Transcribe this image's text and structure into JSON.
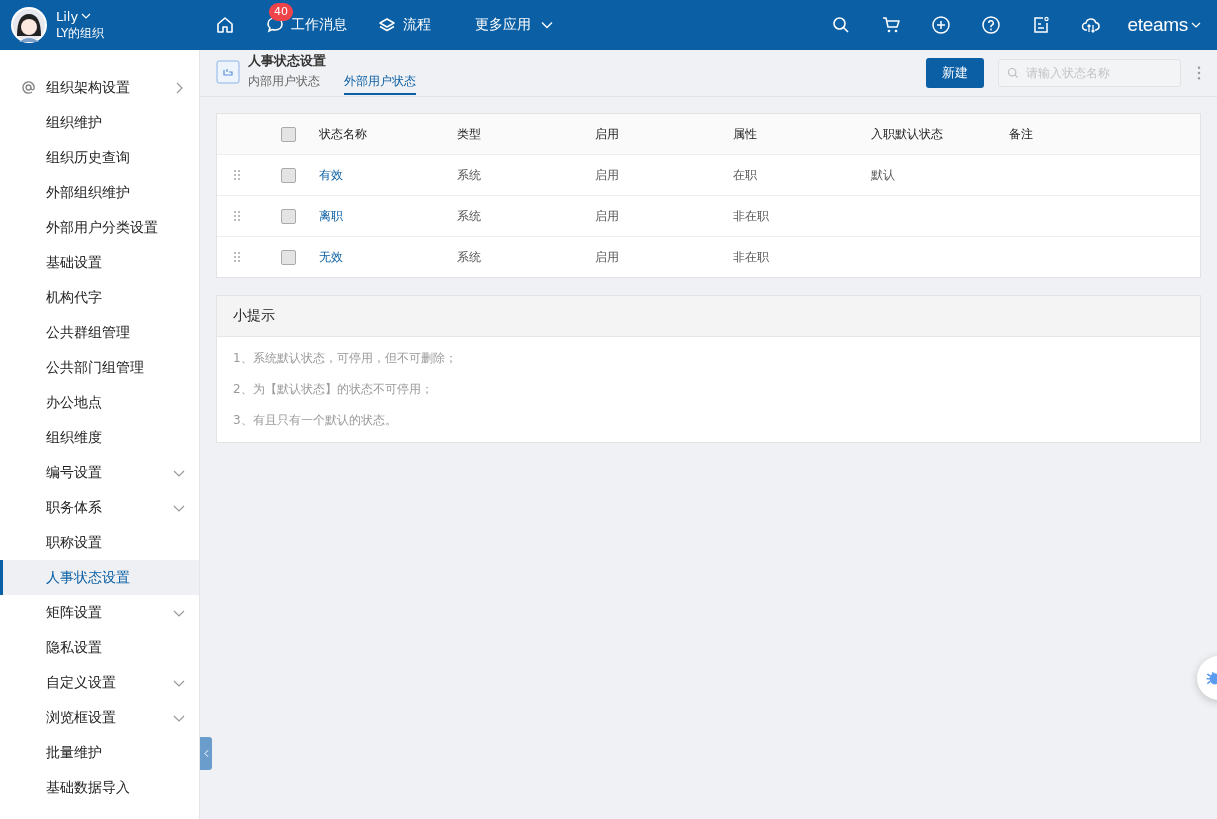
{
  "header": {
    "user": {
      "name": "Lily",
      "org": "LY的组织"
    },
    "nav": [
      {
        "kind": "home"
      },
      {
        "kind": "messages",
        "label": "工作消息",
        "badge": "40"
      },
      {
        "kind": "flow",
        "label": "流程"
      },
      {
        "kind": "more",
        "label": "更多应用"
      }
    ],
    "brand": "eteams"
  },
  "sidebar": {
    "items": [
      {
        "label": "组织架构设置",
        "kind": "section",
        "selected": false
      },
      {
        "label": "组织维护",
        "kind": "link",
        "selected": false
      },
      {
        "label": "组织历史查询",
        "kind": "link",
        "selected": false
      },
      {
        "label": "外部组织维护",
        "kind": "link",
        "selected": false
      },
      {
        "label": "外部用户分类设置",
        "kind": "link",
        "selected": false
      },
      {
        "label": "基础设置",
        "kind": "link",
        "selected": false
      },
      {
        "label": "机构代字",
        "kind": "link",
        "selected": false
      },
      {
        "label": "公共群组管理",
        "kind": "link",
        "selected": false
      },
      {
        "label": "公共部门组管理",
        "kind": "link",
        "selected": false
      },
      {
        "label": "办公地点",
        "kind": "link",
        "selected": false
      },
      {
        "label": "组织维度",
        "kind": "link",
        "selected": false
      },
      {
        "label": "编号设置",
        "kind": "menu",
        "selected": false
      },
      {
        "label": "职务体系",
        "kind": "menu",
        "selected": false
      },
      {
        "label": "职称设置",
        "kind": "link",
        "selected": false
      },
      {
        "label": "人事状态设置",
        "kind": "link",
        "selected": true
      },
      {
        "label": "矩阵设置",
        "kind": "menu",
        "selected": false
      },
      {
        "label": "隐私设置",
        "kind": "link",
        "selected": false
      },
      {
        "label": "自定义设置",
        "kind": "menu",
        "selected": false
      },
      {
        "label": "浏览框设置",
        "kind": "menu",
        "selected": false
      },
      {
        "label": "批量维护",
        "kind": "link",
        "selected": false
      },
      {
        "label": "基础数据导入",
        "kind": "link",
        "selected": false
      }
    ]
  },
  "page": {
    "title": "人事状态设置",
    "tabs": [
      {
        "label": "内部用户状态",
        "selected": false
      },
      {
        "label": "外部用户状态",
        "selected": true
      }
    ],
    "new_button": "新建",
    "search": {
      "placeholder": "请输入状态名称"
    }
  },
  "table": {
    "columns": [
      "状态名称",
      "类型",
      "启用",
      "属性",
      "入职默认状态",
      "备注"
    ],
    "header_checked": false,
    "rows": [
      {
        "checked": false,
        "cells": [
          "有效",
          "系统",
          "启用",
          "在职",
          "默认",
          ""
        ]
      },
      {
        "checked": false,
        "cells": [
          "离职",
          "系统",
          "启用",
          "非在职",
          "",
          ""
        ]
      },
      {
        "checked": false,
        "cells": [
          "无效",
          "系统",
          "启用",
          "非在职",
          "",
          ""
        ]
      }
    ]
  },
  "tips": {
    "title": "小提示",
    "lines": [
      "1、系统默认状态，可停用，但不可删除；",
      "2、为【默认状态】的状态不可停用；",
      "3、有且只有一个默认的状态。"
    ]
  }
}
